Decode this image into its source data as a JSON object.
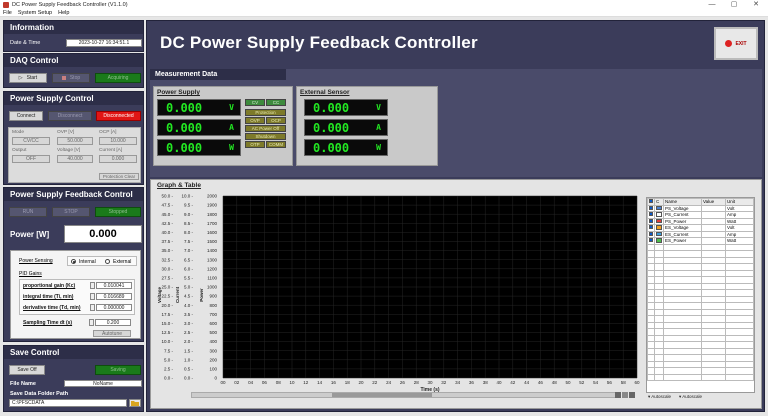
{
  "window": {
    "title": "DC Power Supply Feedback Controller (V1.1.0)",
    "min": "—",
    "max": "▢",
    "close": "✕"
  },
  "menu": [
    "File",
    "System Setup",
    "Help"
  ],
  "information": {
    "title": "Information",
    "datetime_label": "Date & Time",
    "datetime_value": "2023-10-27 16:34:51.1"
  },
  "daq": {
    "title": "DAQ Control",
    "start": "Start",
    "stop": "Stop",
    "status": "Acquiring"
  },
  "psc": {
    "title": "Power Supply Control",
    "connect": "Connect",
    "disconnect": "Disconnect",
    "status": "Disconnected",
    "mode_label": "Mode",
    "mode_value": "CV/CC",
    "ovp_label": "OVP [V]",
    "ovp_value": "50.000",
    "ocp_label": "OCP [A]",
    "ocp_value": "10.000",
    "output_label": "Output",
    "output_value": "OFF",
    "voltage_label": "Voltage [V]",
    "voltage_value": "40.000",
    "current_label": "Current [A]",
    "current_value": "0.000",
    "protection_clear": "Protection Clear"
  },
  "fb": {
    "title": "Power Supply Feedback Control",
    "run": "RUN",
    "stop": "STOP",
    "status": "Stopped",
    "power_label": "Power [W]",
    "power_value": "0.000",
    "sensing_label": "Power Sensing",
    "internal": "Internal",
    "external": "External",
    "pid_title": "PID Gains",
    "kc_label": "proportional gain (Kc)",
    "kc_value": "0.010041",
    "ti_label": "integral time (Ti, min)",
    "ti_value": "0.016689",
    "td_label": "derivative time (Td, min)",
    "td_value": "0.000000",
    "dt_label": "Sampling Time dt (s)",
    "dt_value": "0.200",
    "autotune": "Autotune"
  },
  "save": {
    "title": "Save Control",
    "save_off": "Save Off",
    "status": "Saving",
    "filename_label": "File Name",
    "filename_value": "NoName",
    "folder_label": "Save Data Folder Path",
    "folder_value": "C:\\PFSCDATA",
    "browse_icon": "folder-icon"
  },
  "header": {
    "title": "DC Power Supply Feedback Controller",
    "exit": "EXIT"
  },
  "measurement": {
    "title": "Measurement Data",
    "ps_title": "Power Supply",
    "ps": [
      {
        "value": "0.000",
        "unit": "V"
      },
      {
        "value": "0.000",
        "unit": "A"
      },
      {
        "value": "0.000",
        "unit": "W"
      }
    ],
    "indicators": [
      "CV",
      "CC",
      "Protection",
      "OVP",
      "OCP",
      "AC Power Off",
      "Shutdown",
      "OTP",
      "COMM"
    ],
    "ext_title": "External Sensor",
    "ext": [
      {
        "value": "0.000",
        "unit": "V"
      },
      {
        "value": "0.000",
        "unit": "A"
      },
      {
        "value": "0.000",
        "unit": "W"
      }
    ]
  },
  "graph": {
    "title": "Graph & Table",
    "autoscale_x": "Autoscale",
    "autoscale_y": "Autoscale",
    "legend_headers": [
      "C",
      "Name",
      "Value",
      "Unit"
    ],
    "legend": [
      {
        "name": "PS_Voltage",
        "value": "",
        "unit": "Volt",
        "color": "#4a7fd0"
      },
      {
        "name": "PS_Current",
        "value": "",
        "unit": "Amp",
        "color": "#ffffff"
      },
      {
        "name": "PS_Power",
        "value": "",
        "unit": "Watt",
        "color": "#e23b3b"
      },
      {
        "name": "ES_Voltage",
        "value": "",
        "unit": "Volt",
        "color": "#f0a020"
      },
      {
        "name": "ES_Current",
        "value": "",
        "unit": "Amp",
        "color": "#3c9dde"
      },
      {
        "name": "ES_Power",
        "value": "",
        "unit": "Watt",
        "color": "#4cbf4c"
      }
    ]
  },
  "chart_data": {
    "type": "line",
    "xlabel": "Time (s)",
    "ylabels": [
      "Voltage",
      "Current",
      "Power"
    ],
    "xlim": [
      0,
      60
    ],
    "x_ticks": [
      "00",
      "02",
      "04",
      "06",
      "08",
      "10",
      "12",
      "14",
      "16",
      "18",
      "20",
      "22",
      "24",
      "26",
      "28",
      "30",
      "32",
      "34",
      "36",
      "38",
      "40",
      "42",
      "44",
      "46",
      "48",
      "50",
      "52",
      "54",
      "56",
      "58",
      "60"
    ],
    "y_axes": [
      {
        "name": "Voltage",
        "ticks": [
          "50.0",
          "47.5",
          "45.0",
          "42.5",
          "40.0",
          "37.5",
          "35.0",
          "32.5",
          "30.0",
          "27.5",
          "25.0",
          "22.5",
          "20.0",
          "17.5",
          "15.0",
          "12.5",
          "10.0",
          "7.5",
          "5.0",
          "2.5",
          "0.0"
        ]
      },
      {
        "name": "Current",
        "ticks": [
          "10.0",
          "9.5",
          "9.0",
          "8.5",
          "8.0",
          "7.5",
          "7.0",
          "6.5",
          "6.0",
          "5.5",
          "5.0",
          "4.5",
          "4.0",
          "3.5",
          "3.0",
          "2.5",
          "2.0",
          "1.5",
          "1.0",
          "0.5",
          "0.0"
        ]
      },
      {
        "name": "Power",
        "ticks": [
          "2000",
          "1900",
          "1800",
          "1700",
          "1600",
          "1500",
          "1400",
          "1300",
          "1200",
          "1100",
          "1000",
          "900",
          "800",
          "700",
          "600",
          "500",
          "400",
          "300",
          "200",
          "100",
          "0"
        ]
      }
    ],
    "grid": true,
    "series": []
  }
}
